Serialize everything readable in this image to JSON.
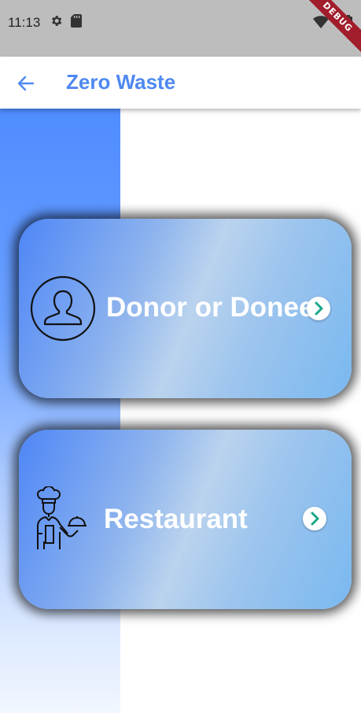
{
  "status_bar": {
    "time": "11:13",
    "icons": [
      "settings-icon",
      "sd-card-icon",
      "wifi-icon",
      "battery-icon"
    ],
    "debug_label": "DEBUG"
  },
  "app_bar": {
    "back_icon": "arrow-back-icon",
    "title": "Zero Waste"
  },
  "cards": [
    {
      "label": "Donor or Donee",
      "icon": "person-icon",
      "chevron": "chevron-right-icon"
    },
    {
      "label": "Restaurant",
      "icon": "chef-icon",
      "chevron": "chevron-right-icon"
    }
  ],
  "colors": {
    "accent": "#4f88f0",
    "status_bar_bg": "#bdbdbd",
    "chevron": "#1aa88a"
  }
}
